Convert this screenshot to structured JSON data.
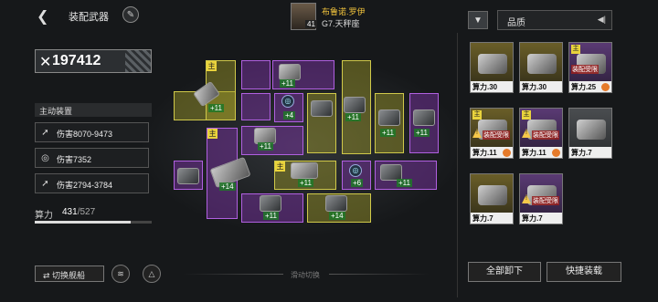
{
  "header": {
    "title": "装配武器",
    "pilot_name": "布鲁诺.罗伊",
    "pilot_sub": "G7.天秤座",
    "pilot_level": "41"
  },
  "power": {
    "value": "197412"
  },
  "skills": {
    "section_label": "主动装置",
    "stats": [
      {
        "icon": "missile-icon",
        "text": "伤害8070-9473"
      },
      {
        "icon": "target-icon",
        "text": "伤害7352"
      },
      {
        "icon": "multi-missile-icon",
        "text": "伤害2794-3784"
      }
    ]
  },
  "cost": {
    "label": "算力",
    "current": "431",
    "max": "/527",
    "fraction": 0.818
  },
  "bottom": {
    "switch_ship": "切换舰船",
    "swipe_hint": "滑动切换",
    "unload_all": "全部卸下",
    "quick_equip": "快捷装载"
  },
  "filter": {
    "sort_label": "品质"
  },
  "slots": {
    "main_tag": "主",
    "badges": [
      "+11",
      "+11",
      "+4",
      "+11",
      "+11",
      "+11",
      "+11",
      "+14",
      "+11",
      "+6",
      "+11",
      "+11",
      "+14"
    ]
  },
  "inventory": [
    {
      "power": "算力.30",
      "main": false,
      "restrict": false,
      "frame": "gold"
    },
    {
      "power": "算力.30",
      "main": false,
      "restrict": false,
      "frame": "gold"
    },
    {
      "power": "算力.25",
      "main": true,
      "restrict": true,
      "restrict_text": "装配受限",
      "frame": "purple"
    },
    {
      "power": "算力.11",
      "main": true,
      "restrict": true,
      "restrict_text": "装配受限",
      "frame": "gold"
    },
    {
      "power": "算力.11",
      "main": true,
      "restrict": true,
      "restrict_text": "装配受限",
      "frame": "purple"
    },
    {
      "power": "算力.7",
      "main": false,
      "restrict": false,
      "frame": "gray"
    },
    {
      "power": "算力.7",
      "main": false,
      "restrict": false,
      "frame": "gold"
    },
    {
      "power": "算力.7",
      "main": false,
      "restrict": true,
      "restrict_text": "装配受限",
      "frame": "purple"
    }
  ],
  "colors": {
    "yellow_slot": "#d0c94a",
    "purple_slot": "#b060e0",
    "accent": "#f0c23c"
  }
}
